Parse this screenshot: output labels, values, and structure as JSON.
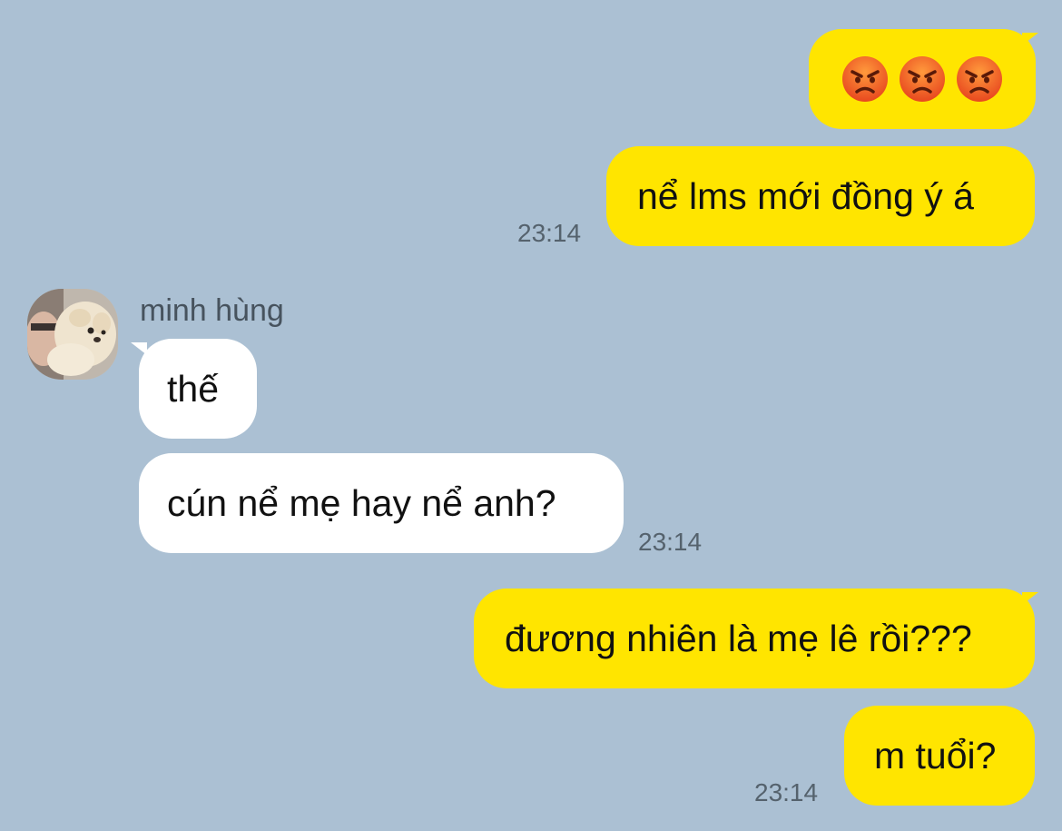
{
  "contact": {
    "name": "minh hùng"
  },
  "messages": [
    {
      "direction": "outgoing",
      "content": "😡😡😡",
      "emoji": [
        "angry-face",
        "angry-face",
        "angry-face"
      ]
    },
    {
      "direction": "outgoing",
      "text": "nể lms mới đồng ý á",
      "time": "23:14"
    },
    {
      "direction": "incoming",
      "text": "thế"
    },
    {
      "direction": "incoming",
      "text": "cún nể mẹ hay nể anh?",
      "time": "23:14"
    },
    {
      "direction": "outgoing",
      "text": "đương nhiên là mẹ lê rồi???"
    },
    {
      "direction": "outgoing",
      "text": "m tuổi?",
      "time": "23:14"
    }
  ],
  "colors": {
    "background": "#abc0d3",
    "outgoing_bubble": "#ffe500",
    "incoming_bubble": "#ffffff",
    "timestamp": "#55626d"
  }
}
